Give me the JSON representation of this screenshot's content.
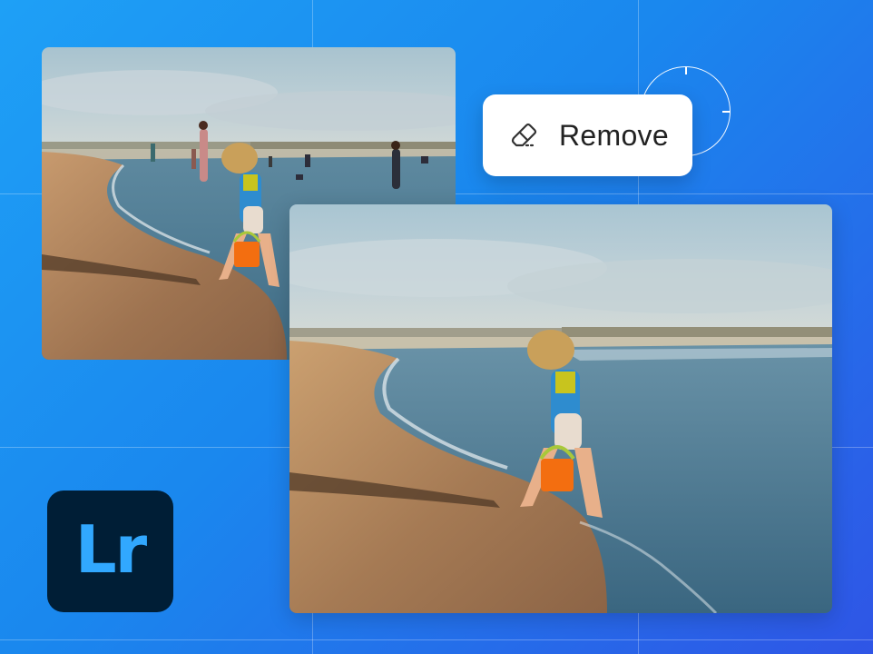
{
  "action_button": {
    "label": "Remove",
    "icon": "eraser-icon"
  },
  "app_logo": {
    "text": "Lr"
  },
  "photos": {
    "before": {
      "description_icon": "beach-photo-with-people"
    },
    "after": {
      "description_icon": "beach-photo-people-removed"
    }
  },
  "colors": {
    "background_start": "#1ea0f6",
    "background_end": "#2f55e6",
    "logo_bg": "#001e36",
    "logo_text": "#31a8ff",
    "button_bg": "#ffffff"
  }
}
